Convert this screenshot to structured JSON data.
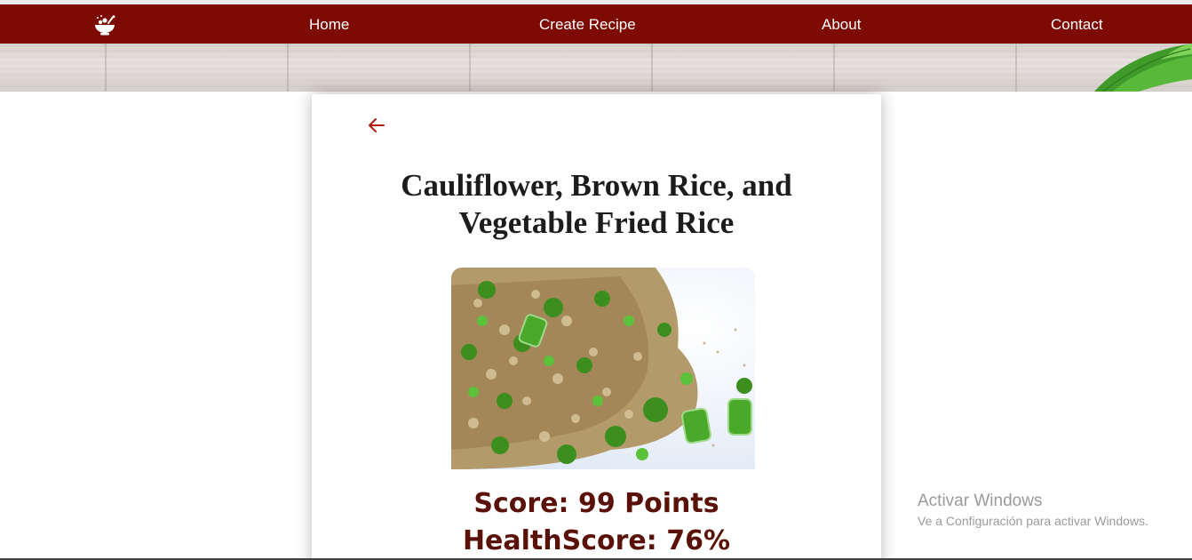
{
  "nav": {
    "logo_icon": "bowl-logo-icon",
    "links": [
      "Home",
      "Create Recipe",
      "About",
      "Contact"
    ]
  },
  "recipe": {
    "back_icon": "arrow-left-icon",
    "title": "Cauliflower, Brown Rice, and Vegetable Fried Rice",
    "score": "Score: 99 Points",
    "health_score": "HealthScore: 76%"
  },
  "watermark": {
    "title": "Activar Windows",
    "subtitle": "Ve a Configuración para activar Windows."
  },
  "colors": {
    "navbar": "#7e0a04",
    "accent": "#b21a12",
    "score_text": "#5a1208"
  }
}
